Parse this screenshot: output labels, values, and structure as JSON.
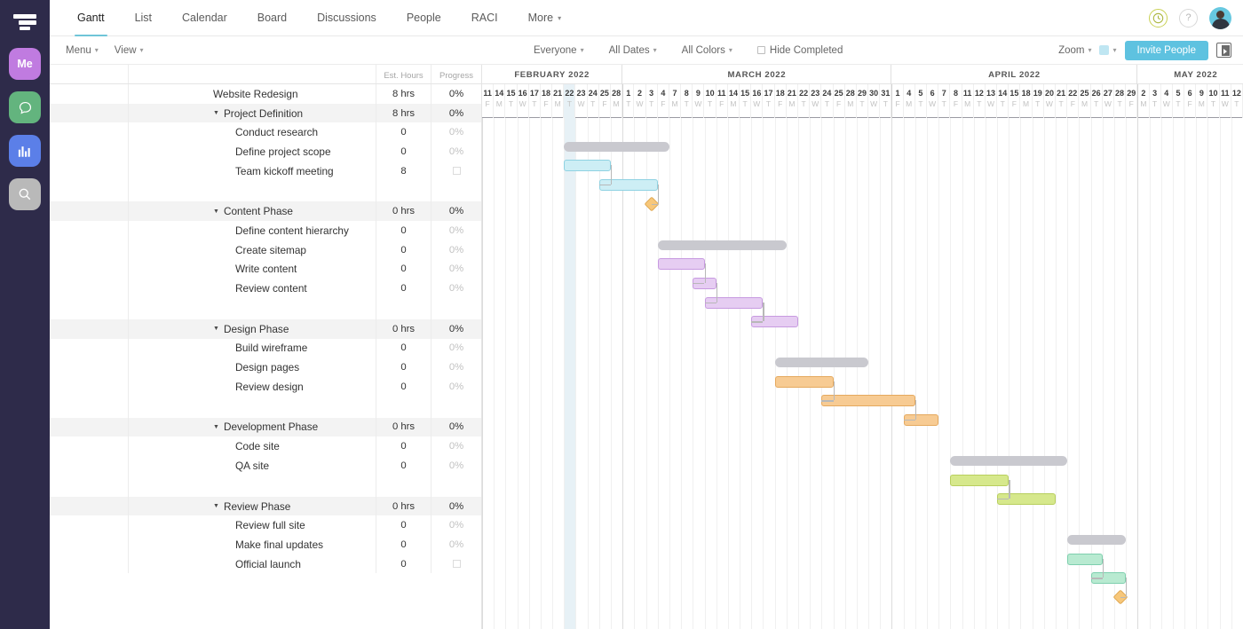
{
  "rail": {
    "logo": "logo-icon",
    "buttons": [
      {
        "name": "me-avatar",
        "label": "Me",
        "color": "#c07be0"
      },
      {
        "name": "chat-icon",
        "label": "",
        "color": "#63b47e"
      },
      {
        "name": "chart-icon",
        "label": "",
        "color": "#5b7fe8"
      },
      {
        "name": "search-icon",
        "label": "",
        "color": "#b9b9b9"
      }
    ]
  },
  "topnav": {
    "tabs": [
      {
        "label": "Gantt",
        "active": true
      },
      {
        "label": "List",
        "active": false
      },
      {
        "label": "Calendar",
        "active": false
      },
      {
        "label": "Board",
        "active": false
      },
      {
        "label": "Discussions",
        "active": false
      },
      {
        "label": "People",
        "active": false
      },
      {
        "label": "RACI",
        "active": false
      },
      {
        "label": "More",
        "active": false,
        "caret": true
      }
    ],
    "clock_icon": "clock-icon",
    "help_icon": "help-icon",
    "avatar": "user-avatar"
  },
  "toolbar": {
    "menu": "Menu",
    "view": "View",
    "everyone": "Everyone",
    "all_dates": "All Dates",
    "all_colors": "All Colors",
    "hide_completed": "Hide Completed",
    "zoom": "Zoom",
    "invite": "Invite People",
    "accent": "#5ec2e0",
    "swatch_color": "#bfe6f2"
  },
  "table": {
    "headers": {
      "est_hours": "Est. Hours",
      "progress": "Progress"
    },
    "rows": [
      {
        "name": "Website Redesign",
        "level": 0,
        "hours": "8 hrs",
        "progress": "0%",
        "shaded": false,
        "collapse": false,
        "faded": false
      },
      {
        "name": "Project Definition",
        "level": 1,
        "hours": "8 hrs",
        "progress": "0%",
        "shaded": true,
        "collapse": true,
        "faded": false
      },
      {
        "name": "Conduct research",
        "level": 2,
        "hours": "0",
        "progress": "0%",
        "shaded": false,
        "collapse": false,
        "faded": true
      },
      {
        "name": "Define project scope",
        "level": 2,
        "hours": "0",
        "progress": "0%",
        "shaded": false,
        "collapse": false,
        "faded": true
      },
      {
        "name": "Team kickoff meeting",
        "level": 2,
        "hours": "8",
        "progress": "",
        "shaded": false,
        "collapse": false,
        "faded": true,
        "checkbox": true
      },
      {
        "name": "",
        "level": 0,
        "hours": "",
        "progress": "",
        "spacer": true
      },
      {
        "name": "Content Phase",
        "level": 1,
        "hours": "0 hrs",
        "progress": "0%",
        "shaded": true,
        "collapse": true,
        "faded": false
      },
      {
        "name": "Define content hierarchy",
        "level": 2,
        "hours": "0",
        "progress": "0%",
        "shaded": false,
        "collapse": false,
        "faded": true
      },
      {
        "name": "Create sitemap",
        "level": 2,
        "hours": "0",
        "progress": "0%",
        "shaded": false,
        "collapse": false,
        "faded": true
      },
      {
        "name": "Write content",
        "level": 2,
        "hours": "0",
        "progress": "0%",
        "shaded": false,
        "collapse": false,
        "faded": true
      },
      {
        "name": "Review content",
        "level": 2,
        "hours": "0",
        "progress": "0%",
        "shaded": false,
        "collapse": false,
        "faded": true
      },
      {
        "name": "",
        "level": 0,
        "hours": "",
        "progress": "",
        "spacer": true
      },
      {
        "name": "Design Phase",
        "level": 1,
        "hours": "0 hrs",
        "progress": "0%",
        "shaded": true,
        "collapse": true,
        "faded": false
      },
      {
        "name": "Build wireframe",
        "level": 2,
        "hours": "0",
        "progress": "0%",
        "shaded": false,
        "collapse": false,
        "faded": true
      },
      {
        "name": "Design pages",
        "level": 2,
        "hours": "0",
        "progress": "0%",
        "shaded": false,
        "collapse": false,
        "faded": true
      },
      {
        "name": "Review design",
        "level": 2,
        "hours": "0",
        "progress": "0%",
        "shaded": false,
        "collapse": false,
        "faded": true
      },
      {
        "name": "",
        "level": 0,
        "hours": "",
        "progress": "",
        "spacer": true
      },
      {
        "name": "Development Phase",
        "level": 1,
        "hours": "0 hrs",
        "progress": "0%",
        "shaded": true,
        "collapse": true,
        "faded": false
      },
      {
        "name": "Code site",
        "level": 2,
        "hours": "0",
        "progress": "0%",
        "shaded": false,
        "collapse": false,
        "faded": true
      },
      {
        "name": "QA site",
        "level": 2,
        "hours": "0",
        "progress": "0%",
        "shaded": false,
        "collapse": false,
        "faded": true
      },
      {
        "name": "",
        "level": 0,
        "hours": "",
        "progress": "",
        "spacer": true
      },
      {
        "name": "Review Phase",
        "level": 1,
        "hours": "0 hrs",
        "progress": "0%",
        "shaded": true,
        "collapse": true,
        "faded": false
      },
      {
        "name": "Review full site",
        "level": 2,
        "hours": "0",
        "progress": "0%",
        "shaded": false,
        "collapse": false,
        "faded": true
      },
      {
        "name": "Make final updates",
        "level": 2,
        "hours": "0",
        "progress": "0%",
        "shaded": false,
        "collapse": false,
        "faded": true
      },
      {
        "name": "Official launch",
        "level": 2,
        "hours": "0",
        "progress": "",
        "shaded": false,
        "collapse": false,
        "faded": true,
        "checkbox": true
      }
    ]
  },
  "chart_data": {
    "type": "gantt",
    "title": "Website Redesign",
    "today_index": 7,
    "months": [
      {
        "label": "FEBRUARY 2022",
        "start": 0,
        "count": 12
      },
      {
        "label": "MARCH 2022",
        "start": 12,
        "count": 23
      },
      {
        "label": "APRIL 2022",
        "start": 35,
        "count": 21
      },
      {
        "label": "MAY 2022",
        "start": 56,
        "count": 10
      }
    ],
    "days": [
      {
        "d": "11",
        "w": "F"
      },
      {
        "d": "14",
        "w": "M"
      },
      {
        "d": "15",
        "w": "T"
      },
      {
        "d": "16",
        "w": "W"
      },
      {
        "d": "17",
        "w": "T"
      },
      {
        "d": "18",
        "w": "F"
      },
      {
        "d": "21",
        "w": "M"
      },
      {
        "d": "22",
        "w": "T"
      },
      {
        "d": "23",
        "w": "W"
      },
      {
        "d": "24",
        "w": "T"
      },
      {
        "d": "25",
        "w": "F"
      },
      {
        "d": "28",
        "w": "M"
      },
      {
        "d": "1",
        "w": "T"
      },
      {
        "d": "2",
        "w": "W"
      },
      {
        "d": "3",
        "w": "T"
      },
      {
        "d": "4",
        "w": "F"
      },
      {
        "d": "7",
        "w": "M"
      },
      {
        "d": "8",
        "w": "T"
      },
      {
        "d": "9",
        "w": "W"
      },
      {
        "d": "10",
        "w": "T"
      },
      {
        "d": "11",
        "w": "F"
      },
      {
        "d": "14",
        "w": "M"
      },
      {
        "d": "15",
        "w": "T"
      },
      {
        "d": "16",
        "w": "W"
      },
      {
        "d": "17",
        "w": "T"
      },
      {
        "d": "18",
        "w": "F"
      },
      {
        "d": "21",
        "w": "M"
      },
      {
        "d": "22",
        "w": "T"
      },
      {
        "d": "23",
        "w": "W"
      },
      {
        "d": "24",
        "w": "T"
      },
      {
        "d": "25",
        "w": "F"
      },
      {
        "d": "28",
        "w": "M"
      },
      {
        "d": "29",
        "w": "T"
      },
      {
        "d": "30",
        "w": "W"
      },
      {
        "d": "31",
        "w": "T"
      },
      {
        "d": "1",
        "w": "F"
      },
      {
        "d": "4",
        "w": "M"
      },
      {
        "d": "5",
        "w": "T"
      },
      {
        "d": "6",
        "w": "W"
      },
      {
        "d": "7",
        "w": "T"
      },
      {
        "d": "8",
        "w": "F"
      },
      {
        "d": "11",
        "w": "M"
      },
      {
        "d": "12",
        "w": "T"
      },
      {
        "d": "13",
        "w": "W"
      },
      {
        "d": "14",
        "w": "T"
      },
      {
        "d": "15",
        "w": "F"
      },
      {
        "d": "18",
        "w": "M"
      },
      {
        "d": "19",
        "w": "T"
      },
      {
        "d": "20",
        "w": "W"
      },
      {
        "d": "21",
        "w": "T"
      },
      {
        "d": "22",
        "w": "F"
      },
      {
        "d": "25",
        "w": "M"
      },
      {
        "d": "26",
        "w": "T"
      },
      {
        "d": "27",
        "w": "W"
      },
      {
        "d": "28",
        "w": "T"
      },
      {
        "d": "29",
        "w": "F"
      },
      {
        "d": "2",
        "w": "M"
      },
      {
        "d": "3",
        "w": "T"
      },
      {
        "d": "4",
        "w": "W"
      },
      {
        "d": "5",
        "w": "T"
      },
      {
        "d": "6",
        "w": "F"
      },
      {
        "d": "9",
        "w": "M"
      },
      {
        "d": "10",
        "w": "T"
      },
      {
        "d": "11",
        "w": "W"
      },
      {
        "d": "12",
        "w": "T"
      }
    ],
    "bars": [
      {
        "task": "Project Definition",
        "row": 1,
        "start": 7,
        "end": 15,
        "kind": "summary",
        "color": "#c9c9cf"
      },
      {
        "task": "Conduct research",
        "row": 2,
        "start": 7,
        "end": 10,
        "kind": "task",
        "color": "#cdeef5",
        "border": "#8fd2e2"
      },
      {
        "task": "Define project scope",
        "row": 3,
        "start": 10,
        "end": 14,
        "kind": "task",
        "color": "#cdeef5",
        "border": "#8fd2e2"
      },
      {
        "task": "Team kickoff meeting",
        "row": 4,
        "start": 14,
        "end": 14,
        "kind": "milestone",
        "color": "#f7c77a"
      },
      {
        "task": "Content Phase",
        "row": 6,
        "start": 15,
        "end": 25,
        "kind": "summary",
        "color": "#c9c9cf"
      },
      {
        "task": "Define content hierarchy",
        "row": 7,
        "start": 15,
        "end": 18,
        "kind": "task",
        "color": "#e6cdf2",
        "border": "#c79ae0"
      },
      {
        "task": "Create sitemap",
        "row": 8,
        "start": 18,
        "end": 19,
        "kind": "task",
        "color": "#e6cdf2",
        "border": "#c79ae0"
      },
      {
        "task": "Write content",
        "row": 9,
        "start": 19,
        "end": 23,
        "kind": "task",
        "color": "#e6cdf2",
        "border": "#c79ae0"
      },
      {
        "task": "Review content",
        "row": 10,
        "start": 23,
        "end": 26,
        "kind": "task",
        "color": "#e6cdf2",
        "border": "#c79ae0"
      },
      {
        "task": "Design Phase",
        "row": 12,
        "start": 25,
        "end": 32,
        "kind": "summary",
        "color": "#c9c9cf"
      },
      {
        "task": "Build wireframe",
        "row": 13,
        "start": 25,
        "end": 29,
        "kind": "task",
        "color": "#f7cb93",
        "border": "#e5a95e"
      },
      {
        "task": "Design pages",
        "row": 14,
        "start": 29,
        "end": 36,
        "kind": "task",
        "color": "#f7cb93",
        "border": "#e5a95e"
      },
      {
        "task": "Review design",
        "row": 15,
        "start": 36,
        "end": 38,
        "kind": "task",
        "color": "#f7cb93",
        "border": "#e5a95e"
      },
      {
        "task": "Development Phase",
        "row": 17,
        "start": 40,
        "end": 49,
        "kind": "summary",
        "color": "#c9c9cf"
      },
      {
        "task": "Code site",
        "row": 18,
        "start": 40,
        "end": 44,
        "kind": "task",
        "color": "#d6e88c",
        "border": "#b8cf5e"
      },
      {
        "task": "QA site",
        "row": 19,
        "start": 44,
        "end": 48,
        "kind": "task",
        "color": "#d6e88c",
        "border": "#b8cf5e"
      },
      {
        "task": "Review Phase",
        "row": 21,
        "start": 50,
        "end": 54,
        "kind": "summary",
        "color": "#c9c9cf"
      },
      {
        "task": "Review full site",
        "row": 22,
        "start": 50,
        "end": 52,
        "kind": "task",
        "color": "#b8ead1",
        "border": "#7ecfae"
      },
      {
        "task": "Make final updates",
        "row": 23,
        "start": 52,
        "end": 54,
        "kind": "task",
        "color": "#b8ead1",
        "border": "#7ecfae"
      },
      {
        "task": "Official launch",
        "row": 24,
        "start": 54,
        "end": 54,
        "kind": "milestone",
        "color": "#f7c77a"
      }
    ]
  }
}
